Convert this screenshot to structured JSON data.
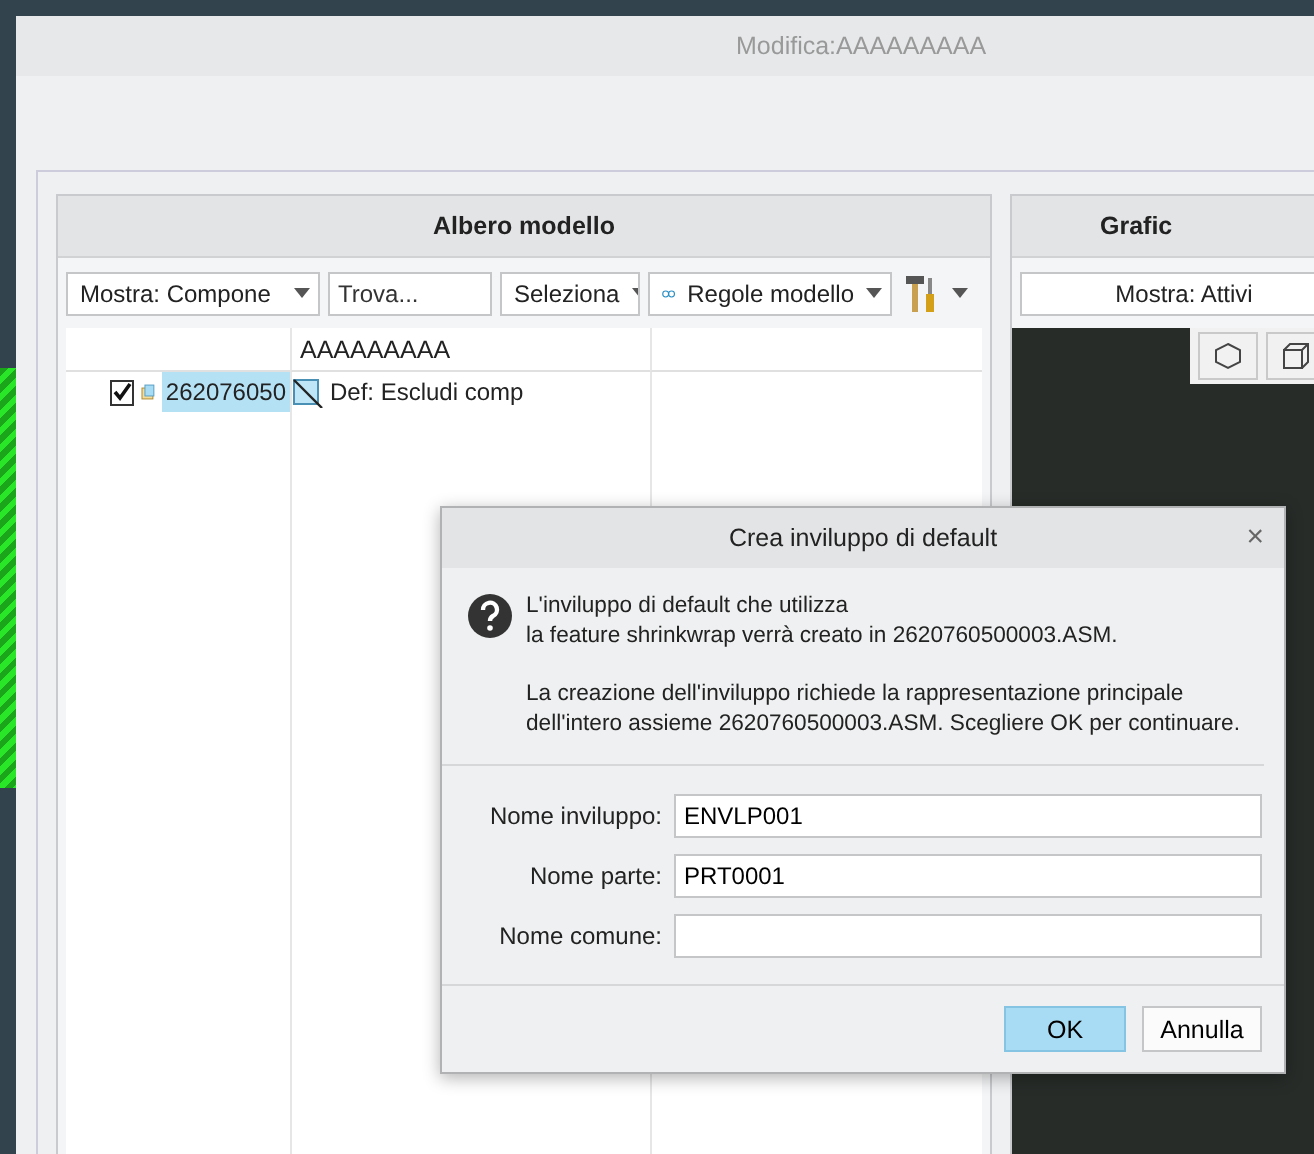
{
  "window": {
    "title": "Modifica:AAAAAAAAA"
  },
  "tree_panel": {
    "title": "Albero modello",
    "toolbar": [
      {
        "kind": "dropdown",
        "label": "Mostra: Compone"
      },
      {
        "kind": "search",
        "placeholder": "Trova..."
      },
      {
        "kind": "dropdown",
        "label": "Seleziona"
      },
      {
        "kind": "rules",
        "label": "Regole modello"
      },
      {
        "kind": "tools"
      }
    ],
    "columns": [
      "AAAAAAAAA"
    ],
    "rows": [
      {
        "checked": true,
        "name": "262076050",
        "selected": true,
        "cells": [
          "Def: Escludi comp"
        ]
      }
    ]
  },
  "graphics_panel": {
    "title": "Grafic",
    "show": "Mostra: Attivi"
  },
  "dialog": {
    "title": "Crea inviluppo di default",
    "close": "×",
    "message": [
      "L'inviluppo di default che utilizza",
      "la feature shrinkwrap verrà creato in 2620760500003.ASM."
    ],
    "note": [
      "La creazione dell'inviluppo richiede la rappresentazione principale",
      "dell'intero assieme 2620760500003.ASM. Scegliere OK per continuare."
    ],
    "fields": [
      {
        "label": "Nome inviluppo:",
        "value": "ENVLP001"
      },
      {
        "label": "Nome parte:",
        "value": "PRT0001"
      },
      {
        "label": "Nome comune:"
      }
    ],
    "buttons": [
      {
        "label": "OK",
        "default": true
      },
      {
        "label": "Annulla",
        "default": false
      }
    ]
  }
}
